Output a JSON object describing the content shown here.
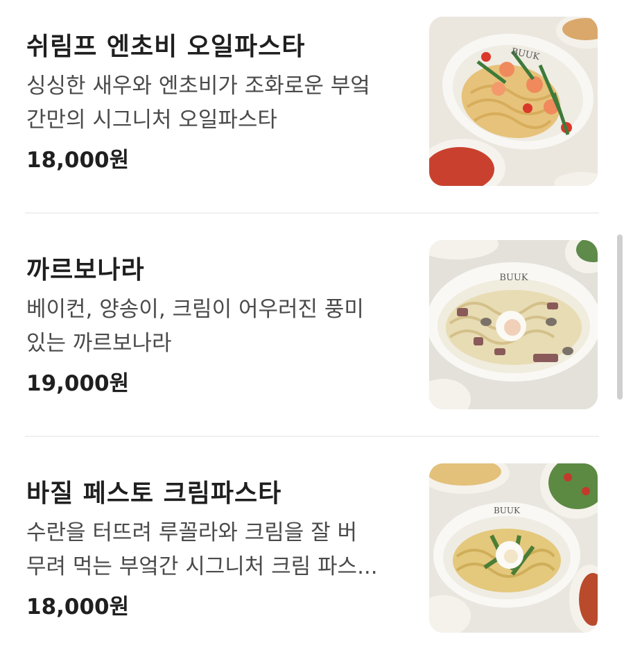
{
  "menu": {
    "items": [
      {
        "name": "쉬림프 엔초비 오일파스타",
        "description_lines": [
          "싱싱한 새우와 엔초비가 조화로운 부엌",
          "간만의 시그니처 오일파스타"
        ],
        "price": "18,000원",
        "plate_text": "BUUK"
      },
      {
        "name": "까르보나라",
        "description_lines": [
          "베이컨, 양송이, 크림이 어우러진 풍미",
          "있는 까르보나라"
        ],
        "price": "19,000원",
        "plate_text": "BUUK"
      },
      {
        "name": "바질 페스토 크림파스타",
        "description_lines": [
          "수란을 터뜨려 루꼴라와 크림을 잘 버",
          "무려 먹는 부엌간 시그니처 크림 파스..."
        ],
        "price": "18,000원",
        "plate_text": "BUUK"
      }
    ]
  },
  "colors": {
    "text_primary": "#1f1f1f",
    "text_secondary": "#4a4a4a",
    "divider": "#f0f0f0"
  }
}
